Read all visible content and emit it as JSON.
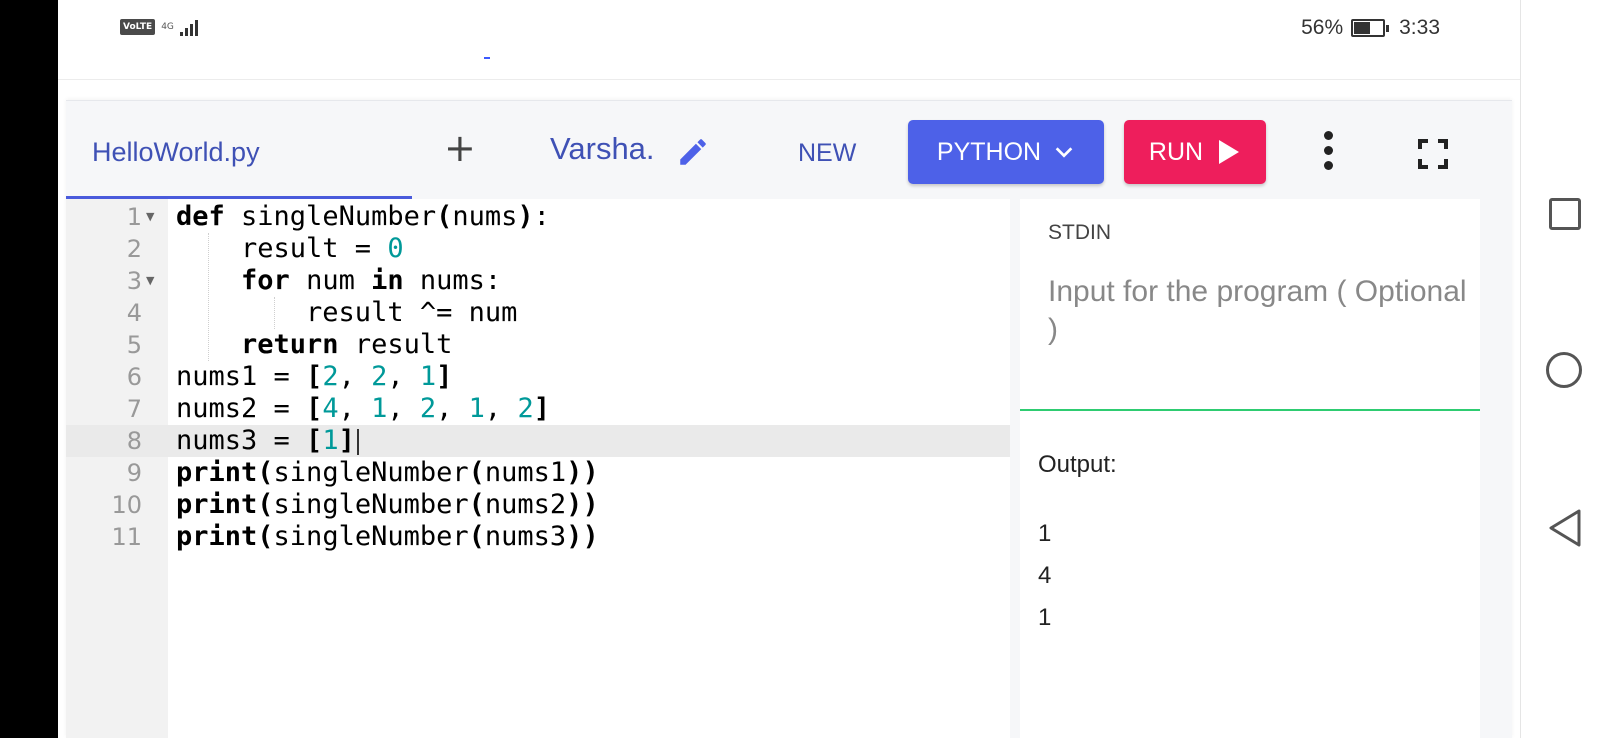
{
  "status_bar": {
    "volte": "VoLTE",
    "network": "4G",
    "battery_percent": "56%",
    "battery_level": 0.56,
    "time": "3:33"
  },
  "toolbar": {
    "file_tab": "HelloWorld.py",
    "add_icon": "plus-icon",
    "user_name": "Varsha.",
    "edit_icon": "pencil-icon",
    "new_label": "NEW",
    "language_label": "PYTHON",
    "language_icon": "chevron-down-icon",
    "run_label": "RUN",
    "run_icon": "play-icon",
    "more_icon": "more-vertical-icon",
    "fullscreen_icon": "fullscreen-icon"
  },
  "editor": {
    "active_line": 8,
    "line_numbers": [
      "1",
      "2",
      "3",
      "4",
      "5",
      "6",
      "7",
      "8",
      "9",
      "10",
      "11"
    ],
    "folded_lines": [
      1,
      3
    ],
    "code_lines": [
      "def singleNumber(nums):",
      "    result = 0",
      "    for num in nums:",
      "        result ^= num",
      "    return result",
      "nums1 = [2, 2, 1]",
      "nums2 = [4, 1, 2, 1, 2]",
      "nums3 = [1]",
      "print(singleNumber(nums1))",
      "print(singleNumber(nums2))",
      "print(singleNumber(nums3))"
    ]
  },
  "stdin": {
    "label": "STDIN",
    "placeholder": "Input for the program ( Optional )"
  },
  "output": {
    "label": "Output:",
    "lines": [
      "1",
      "4",
      "1"
    ]
  },
  "colors": {
    "accent": "#4d61e8",
    "run": "#ee1e5c",
    "divider": "#2ecc71",
    "number": "#009999"
  }
}
